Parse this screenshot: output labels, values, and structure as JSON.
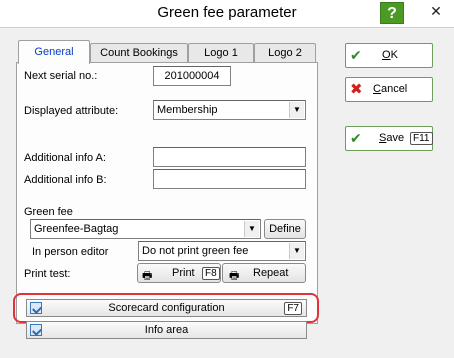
{
  "window": {
    "title": "Green fee parameter",
    "help_label": "?",
    "close_label": "✕"
  },
  "tabs": [
    {
      "label": "General"
    },
    {
      "label": "Count Bookings"
    },
    {
      "label": "Logo 1"
    },
    {
      "label": "Logo 2"
    }
  ],
  "general": {
    "serial": {
      "label": "Next serial no.:",
      "value": "201000004"
    },
    "attribute": {
      "label": "Displayed attribute:",
      "value": "Membership"
    },
    "info_a": {
      "label": "Additional info A:",
      "value": ""
    },
    "info_b": {
      "label": "Additional info B:",
      "value": ""
    },
    "green_fee": {
      "label": "Green fee",
      "value": "Greenfee-Bagtag",
      "define_label": "Define"
    },
    "person_editor": {
      "label": "In person editor",
      "value": "Do not print green fee"
    },
    "print_test": {
      "label": "Print test:",
      "print_label": "Print",
      "print_key": "F8",
      "repeat_label": "Repeat"
    },
    "scorecard": {
      "label": "Scorecard configuration",
      "key": "F7"
    },
    "info_area": {
      "label": "Info area"
    }
  },
  "actions": {
    "ok_label": "OK",
    "cancel_label": "Cancel",
    "save_label": "Save",
    "save_key": "F11"
  },
  "colors": {
    "accent": "#0a3cc8",
    "highlight": "#e0343a",
    "help_bg": "#4a9a24"
  }
}
